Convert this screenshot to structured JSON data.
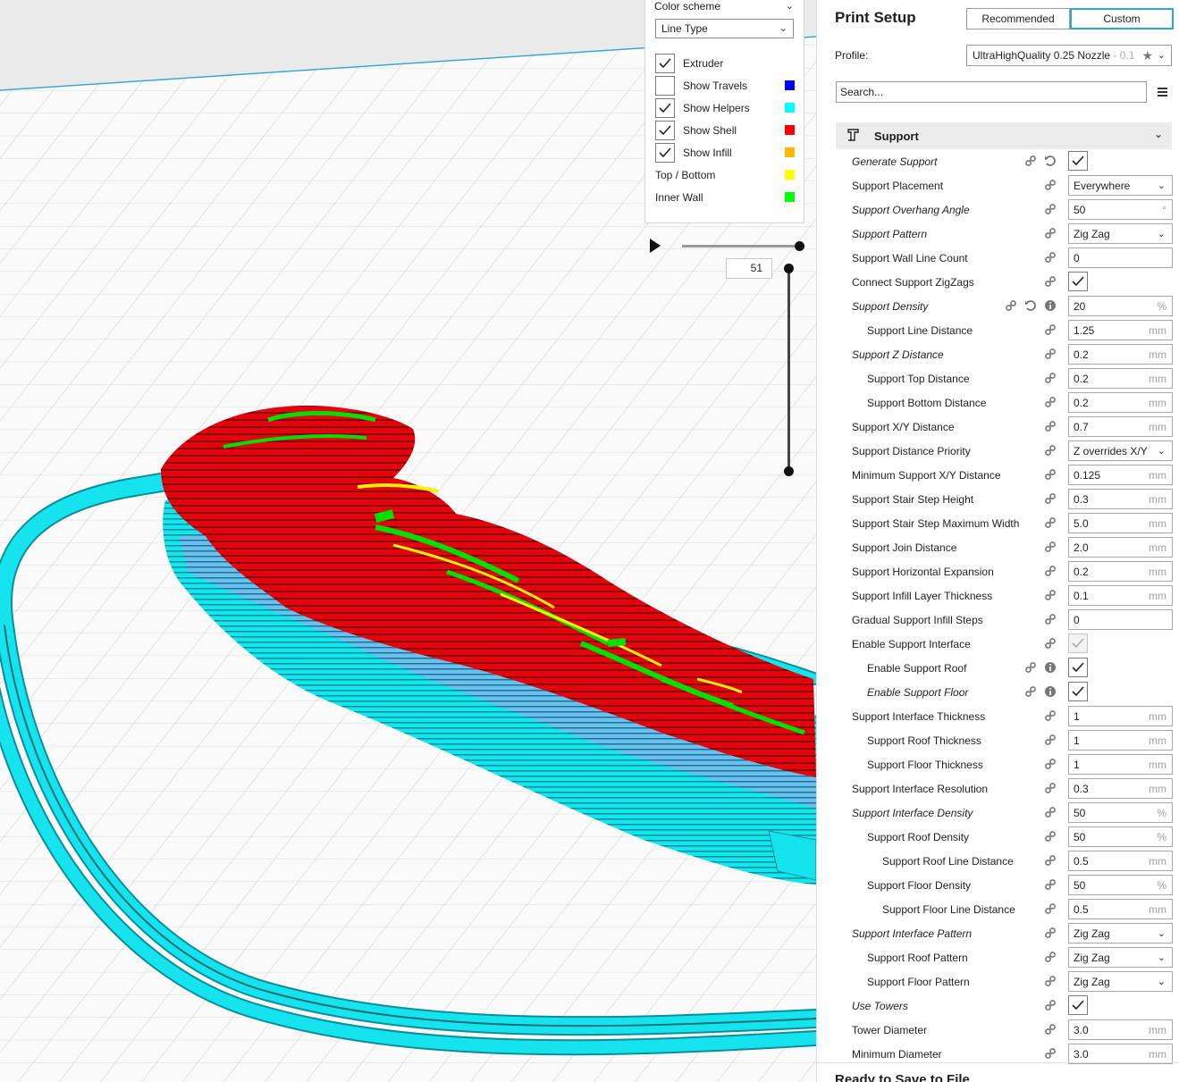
{
  "view_panel": {
    "color_scheme_label": "Color scheme",
    "line_type_value": "Line Type",
    "items": [
      {
        "label": "Extruder",
        "checked": true,
        "color": ""
      },
      {
        "label": "Show Travels",
        "checked": false,
        "color": "#0000ff"
      },
      {
        "label": "Show Helpers",
        "checked": true,
        "color": "#00ffff"
      },
      {
        "label": "Show Shell",
        "checked": true,
        "color": "#ff0000"
      },
      {
        "label": "Show Infill",
        "checked": true,
        "color": "#ffb700"
      }
    ],
    "legend": [
      {
        "label": "Top / Bottom",
        "color": "#ffff00"
      },
      {
        "label": "Inner Wall",
        "color": "#00ff00"
      }
    ]
  },
  "layer_slider": {
    "value": "51"
  },
  "print_setup": {
    "title": "Print Setup",
    "mode_recommended": "Recommended",
    "mode_custom": "Custom",
    "profile_label": "Profile:",
    "profile_value": "UltraHighQuality 0.25 Nozzle",
    "profile_suffix": " - 0.1",
    "search_placeholder": "Search...",
    "category": "Support",
    "settings": [
      {
        "label": "Generate Support",
        "indent": 0,
        "italic": true,
        "type": "checkbox",
        "checked": true,
        "icons": [
          "link",
          "reset"
        ]
      },
      {
        "label": "Support Placement",
        "indent": 0,
        "italic": false,
        "type": "select",
        "value": "Everywhere",
        "icons": [
          "link"
        ]
      },
      {
        "label": "Support Overhang Angle",
        "indent": 0,
        "italic": true,
        "type": "text",
        "value": "50",
        "unit": "°",
        "icons": [
          "link"
        ]
      },
      {
        "label": "Support Pattern",
        "indent": 0,
        "italic": true,
        "type": "select",
        "value": "Zig Zag",
        "icons": [
          "link"
        ]
      },
      {
        "label": "Support Wall Line Count",
        "indent": 0,
        "italic": false,
        "type": "text",
        "value": "0",
        "unit": "",
        "icons": [
          "link"
        ]
      },
      {
        "label": "Connect Support ZigZags",
        "indent": 0,
        "italic": false,
        "type": "checkbox",
        "checked": true,
        "icons": [
          "link"
        ]
      },
      {
        "label": "Support Density",
        "indent": 0,
        "italic": true,
        "type": "text",
        "value": "20",
        "unit": "%",
        "icons": [
          "link",
          "reset",
          "info"
        ]
      },
      {
        "label": "Support Line Distance",
        "indent": 1,
        "italic": false,
        "type": "text",
        "value": "1.25",
        "unit": "mm",
        "icons": [
          "link"
        ]
      },
      {
        "label": "Support Z Distance",
        "indent": 0,
        "italic": true,
        "type": "text",
        "value": "0.2",
        "unit": "mm",
        "icons": [
          "link"
        ]
      },
      {
        "label": "Support Top Distance",
        "indent": 1,
        "italic": false,
        "type": "text",
        "value": "0.2",
        "unit": "mm",
        "icons": [
          "link"
        ]
      },
      {
        "label": "Support Bottom Distance",
        "indent": 1,
        "italic": false,
        "type": "text",
        "value": "0.2",
        "unit": "mm",
        "icons": [
          "link"
        ]
      },
      {
        "label": "Support X/Y Distance",
        "indent": 0,
        "italic": false,
        "type": "text",
        "value": "0.7",
        "unit": "mm",
        "icons": [
          "link"
        ]
      },
      {
        "label": "Support Distance Priority",
        "indent": 0,
        "italic": false,
        "type": "select",
        "value": "Z overrides X/Y",
        "icons": [
          "link"
        ]
      },
      {
        "label": "Minimum Support X/Y Distance",
        "indent": 0,
        "italic": false,
        "type": "text",
        "value": "0.125",
        "unit": "mm",
        "icons": [
          "link"
        ]
      },
      {
        "label": "Support Stair Step Height",
        "indent": 0,
        "italic": false,
        "type": "text",
        "value": "0.3",
        "unit": "mm",
        "icons": [
          "link"
        ]
      },
      {
        "label": "Support Stair Step Maximum Width",
        "indent": 0,
        "italic": false,
        "type": "text",
        "value": "5.0",
        "unit": "mm",
        "icons": [
          "link"
        ]
      },
      {
        "label": "Support Join Distance",
        "indent": 0,
        "italic": false,
        "type": "text",
        "value": "2.0",
        "unit": "mm",
        "icons": [
          "link"
        ]
      },
      {
        "label": "Support Horizontal Expansion",
        "indent": 0,
        "italic": false,
        "type": "text",
        "value": "0.2",
        "unit": "mm",
        "icons": [
          "link"
        ]
      },
      {
        "label": "Support Infill Layer Thickness",
        "indent": 0,
        "italic": false,
        "type": "text",
        "value": "0.1",
        "unit": "mm",
        "icons": [
          "link"
        ]
      },
      {
        "label": "Gradual Support Infill Steps",
        "indent": 0,
        "italic": false,
        "type": "text",
        "value": "0",
        "unit": "",
        "icons": [
          "link"
        ]
      },
      {
        "label": "Enable Support Interface",
        "indent": 0,
        "italic": false,
        "type": "checkbox",
        "checked": true,
        "disabled": true,
        "icons": [
          "link"
        ]
      },
      {
        "label": "Enable Support Roof",
        "indent": 1,
        "italic": false,
        "type": "checkbox",
        "checked": true,
        "icons": [
          "link",
          "info"
        ]
      },
      {
        "label": "Enable Support Floor",
        "indent": 1,
        "italic": true,
        "type": "checkbox",
        "checked": true,
        "icons": [
          "link",
          "info"
        ]
      },
      {
        "label": "Support Interface Thickness",
        "indent": 0,
        "italic": false,
        "type": "text",
        "value": "1",
        "unit": "mm",
        "icons": [
          "link"
        ]
      },
      {
        "label": "Support Roof Thickness",
        "indent": 1,
        "italic": false,
        "type": "text",
        "value": "1",
        "unit": "mm",
        "icons": [
          "link"
        ]
      },
      {
        "label": "Support Floor Thickness",
        "indent": 1,
        "italic": false,
        "type": "text",
        "value": "1",
        "unit": "mm",
        "icons": [
          "link"
        ]
      },
      {
        "label": "Support Interface Resolution",
        "indent": 0,
        "italic": false,
        "type": "text",
        "value": "0.3",
        "unit": "mm",
        "icons": [
          "link"
        ]
      },
      {
        "label": "Support Interface Density",
        "indent": 0,
        "italic": true,
        "type": "text",
        "value": "50",
        "unit": "%",
        "icons": [
          "link"
        ]
      },
      {
        "label": "Support Roof Density",
        "indent": 1,
        "italic": false,
        "type": "text",
        "value": "50",
        "unit": "%",
        "icons": [
          "link"
        ]
      },
      {
        "label": "Support Roof Line Distance",
        "indent": 2,
        "italic": false,
        "type": "text",
        "value": "0.5",
        "unit": "mm",
        "icons": [
          "link"
        ]
      },
      {
        "label": "Support Floor Density",
        "indent": 1,
        "italic": false,
        "type": "text",
        "value": "50",
        "unit": "%",
        "icons": [
          "link"
        ]
      },
      {
        "label": "Support Floor Line Distance",
        "indent": 2,
        "italic": false,
        "type": "text",
        "value": "0.5",
        "unit": "mm",
        "icons": [
          "link"
        ]
      },
      {
        "label": "Support Interface Pattern",
        "indent": 0,
        "italic": true,
        "type": "select",
        "value": "Zig Zag",
        "icons": [
          "link"
        ]
      },
      {
        "label": "Support Roof Pattern",
        "indent": 1,
        "italic": false,
        "type": "select",
        "value": "Zig Zag",
        "icons": [
          "link"
        ]
      },
      {
        "label": "Support Floor Pattern",
        "indent": 1,
        "italic": false,
        "type": "select",
        "value": "Zig Zag",
        "icons": [
          "link"
        ]
      },
      {
        "label": "Use Towers",
        "indent": 0,
        "italic": true,
        "type": "checkbox",
        "checked": true,
        "icons": [
          "link"
        ]
      },
      {
        "label": "Tower Diameter",
        "indent": 0,
        "italic": false,
        "type": "text",
        "value": "3.0",
        "unit": "mm",
        "icons": [
          "link"
        ]
      },
      {
        "label": "Minimum Diameter",
        "indent": 0,
        "italic": false,
        "type": "text",
        "value": "3.0",
        "unit": "mm",
        "icons": [
          "link"
        ]
      }
    ],
    "footer_title": "Ready to Save to File"
  }
}
